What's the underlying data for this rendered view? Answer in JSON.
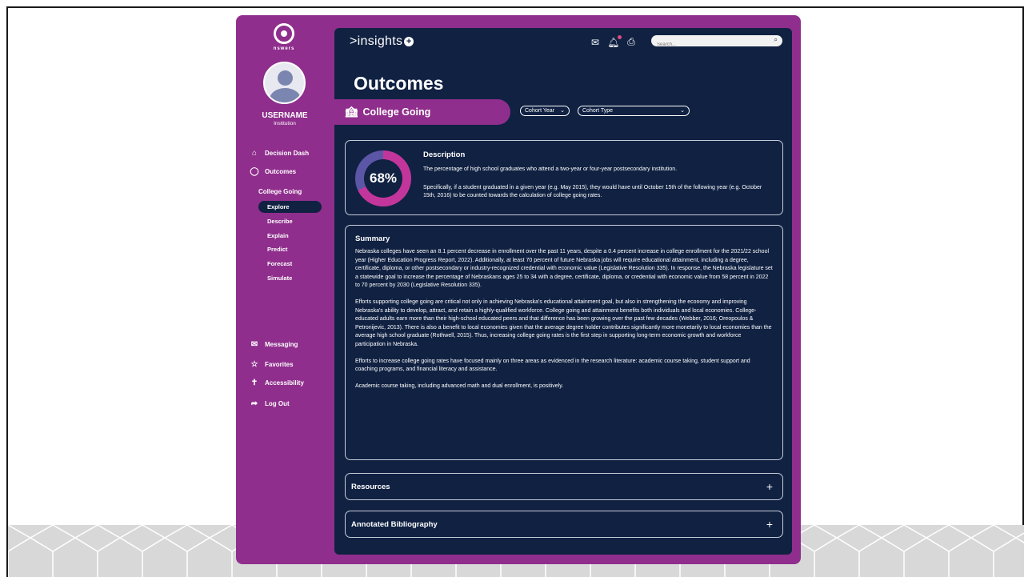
{
  "brand": {
    "prefix": ">insights",
    "plus": "+"
  },
  "logo": {
    "name": "nswers"
  },
  "user": {
    "name": "USERNAME",
    "institution": "Institution"
  },
  "sidebar": {
    "main_items": [
      {
        "label": "Decision Dash",
        "icon": "home-icon"
      },
      {
        "label": "Outcomes",
        "icon": "graduation-icon"
      }
    ],
    "section_title": "College Going",
    "sub_items": [
      {
        "label": "Explore",
        "active": true
      },
      {
        "label": "Describe"
      },
      {
        "label": "Explain"
      },
      {
        "label": "Predict"
      },
      {
        "label": "Forecast"
      },
      {
        "label": "Simulate"
      }
    ],
    "bottom_items": [
      {
        "label": "Messaging",
        "icon": "chat-icon"
      },
      {
        "label": "Favorites",
        "icon": "star-icon"
      },
      {
        "label": "Accessibility",
        "icon": "accessibility-icon"
      },
      {
        "label": "Log Out",
        "icon": "logout-icon"
      }
    ]
  },
  "header": {
    "search_placeholder": "Search...",
    "icons": [
      "mail-icon",
      "bell-icon",
      "print-icon",
      "search-icon"
    ]
  },
  "page": {
    "title": "Outcomes",
    "banner_label": "College Going",
    "filters": [
      {
        "label": "Cohort Year"
      },
      {
        "label": "Cohort Type"
      }
    ]
  },
  "description": {
    "percent": "68%",
    "percent_value": 68,
    "title": "Description",
    "p1": "The percentage of high school graduates who attend a two-year or four-year postsecondary institution.",
    "p2": "Specifically, if a student graduated in a given year (e.g. May 2015), they would have until October 15th of the following year (e.g. October 15th, 2016) to be counted towards the calculation of college going rates."
  },
  "summary": {
    "title": "Summary",
    "paragraphs": [
      "Nebraska colleges have seen an 8.1 percent decrease in enrollment over the past 11 years, despite a 0.4 percent increase in college enrollment for the 2021/22 school year (Higher Education Progress Report, 2022). Additionally, at least 70 percent of future Nebraska jobs will require educational attainment, including a degree, certificate, diploma, or other postsecondary or industry-recognized credential with economic value (Legislative Resolution 335). In response, the Nebraska legislature set a statewide goal to increase the percentage of Nebraskans ages 25 to 34 with a degree, certificate, diploma, or credential with economic value from 58 percent in 2022 to 70 percent by 2030 (Legislative Resolution 335).",
      "Efforts supporting college going are critical not only in achieving Nebraska's educational attainment goal, but also in strengthening the economy and improving Nebraska's ability to develop, attract, and retain a highly-qualified workforce. College going and attainment benefits both individuals and local economies. College-educated adults earn more than their high-school educated peers and that difference has been growing over the past few decades (Webber, 2016; Oreopoulos & Petronijevic, 2013). There is also a benefit to local economies given that the average degree holder contributes significantly more monetarily to local economies than the average high school graduate (Rothwell, 2015). Thus, increasing college going rates is the first step in supporting long-term economic growth and workforce participation in Nebraska.",
      "Efforts to increase college going rates have focused mainly on three areas as evidenced in the research literature: academic course taking, student support and coaching programs, and financial literacy and assistance.",
      "Academic course taking, including advanced math and dual enrollment, is positively."
    ]
  },
  "accordions": [
    {
      "label": "Resources",
      "toggle": "+"
    },
    {
      "label": "Annotated Bibliography",
      "toggle": "+"
    }
  ],
  "colors": {
    "purple": "#8f2e8c",
    "navy": "#102142",
    "donut_primary": "#c2369c",
    "donut_secondary": "#5b56a6"
  }
}
